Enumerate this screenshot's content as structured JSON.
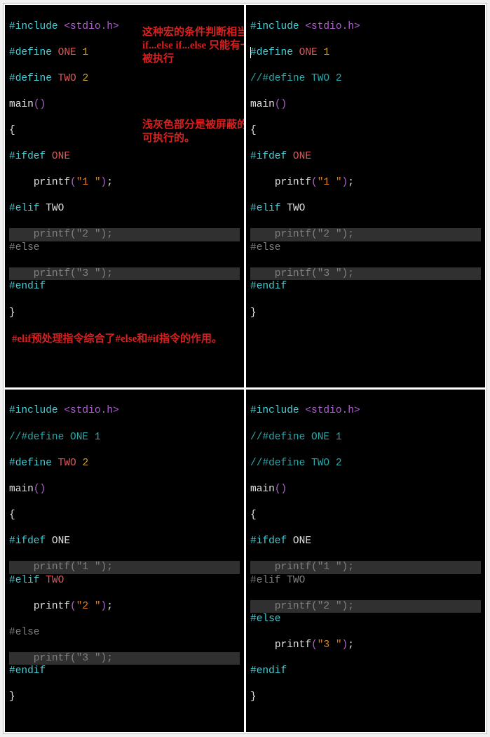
{
  "common": {
    "include": "#include",
    "header": "<stdio.h>",
    "define": "#define",
    "one": "ONE",
    "two": "TWO",
    "n1": "1",
    "n2": "2",
    "main": "main",
    "lparen": "(",
    "rparen": ")",
    "lbrace": "{",
    "rbrace": "}",
    "ifdef": "#ifdef",
    "elif": "#elif",
    "else": "#else",
    "endif": "#endif",
    "printf": "printf",
    "s1": "\"1 \"",
    "s2": "\"2 \"",
    "s3": "\"3 \"",
    "semi": ";",
    "cmt_one": "//#define ONE 1",
    "cmt_two": "//#define TWO 2"
  },
  "annot": {
    "a1": "这种宏的条件判断相当于\nif...else if...else\n只能有一个被执行",
    "a2": "浅灰色部分是被屏蔽的，不可执行的。",
    "footnote": "#elif预处理指令综合了#else和#if指令的作用。"
  }
}
